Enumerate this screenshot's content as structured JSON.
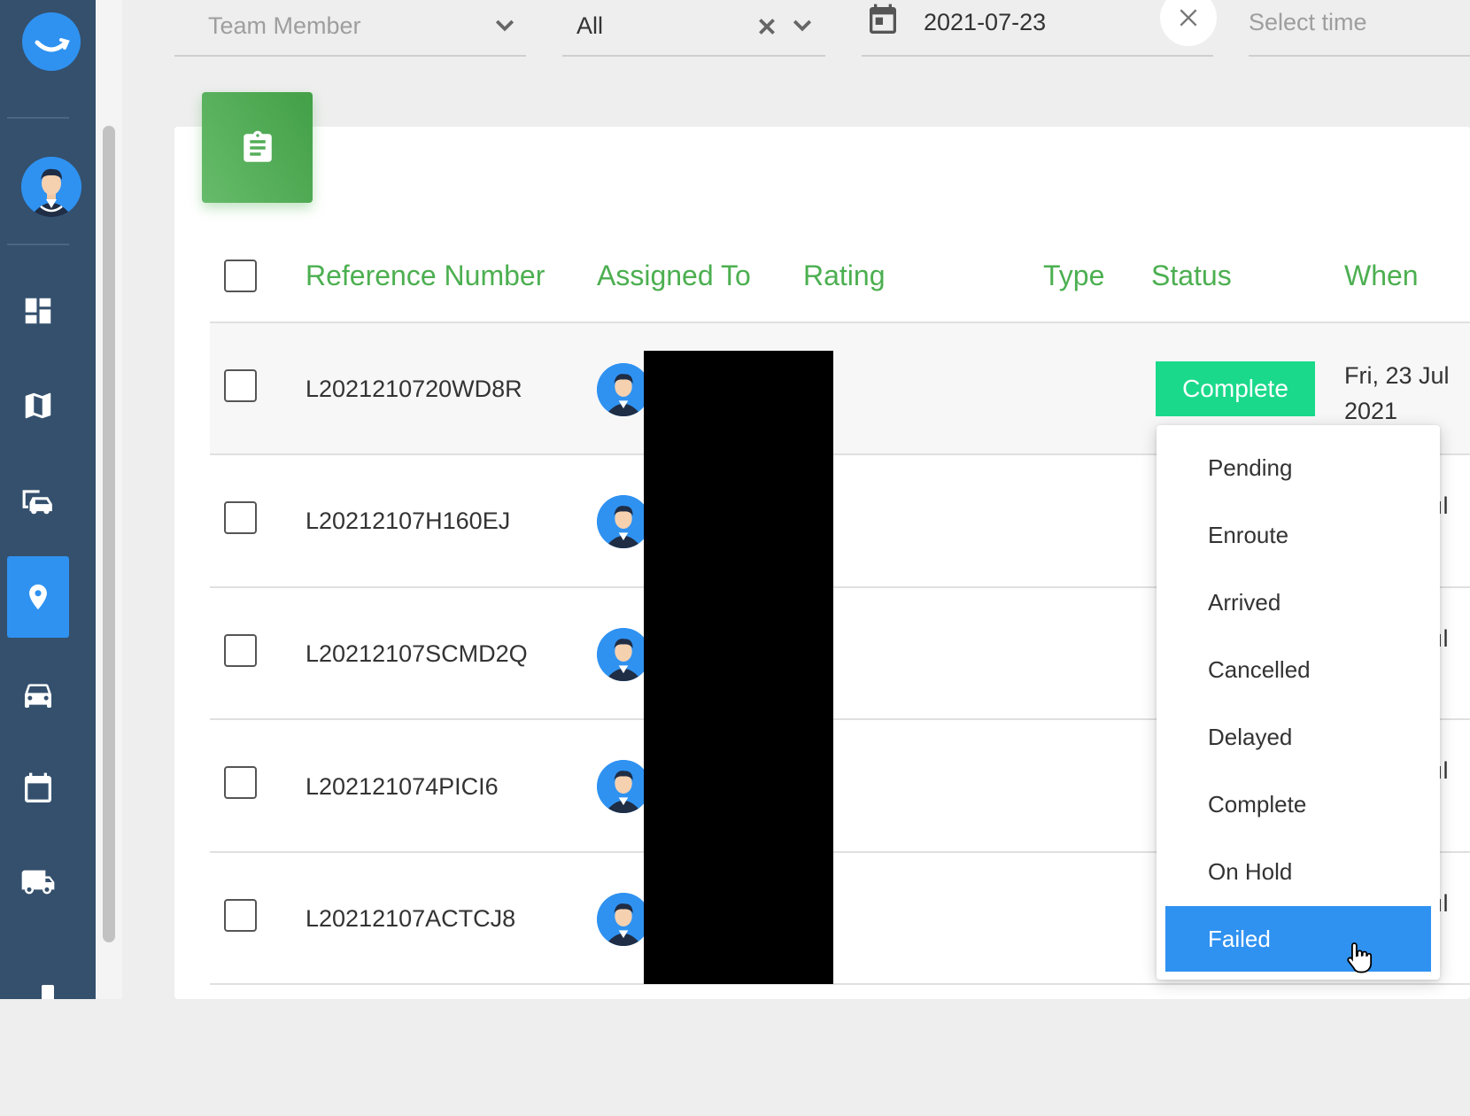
{
  "filters": {
    "team_member_placeholder": "Team Member",
    "status_value": "All",
    "date_value": "2021-07-23",
    "time_placeholder": "Select time"
  },
  "table": {
    "columns": [
      "Reference Number",
      "Assigned To",
      "Rating",
      "Type",
      "Status",
      "When"
    ],
    "rows": [
      {
        "ref": "L2021210720WD8R",
        "status": "Complete",
        "when_line1": "Fri, 23 Jul",
        "when_line2": "2021"
      },
      {
        "ref": "L20212107H160EJ",
        "when_cut": "ıl"
      },
      {
        "ref": "L20212107SCMD2Q",
        "when_cut": "ıl"
      },
      {
        "ref": "L202121074PICI6",
        "when_cut": "ıl"
      },
      {
        "ref": "L20212107ACTCJ8",
        "when_cut": "ıl"
      }
    ]
  },
  "status_dropdown": {
    "options": [
      "Pending",
      "Enroute",
      "Arrived",
      "Cancelled",
      "Delayed",
      "Complete",
      "On Hold",
      "Failed"
    ],
    "highlighted": "Failed"
  },
  "colors": {
    "sidebar": "#34506d",
    "accent_blue": "#2f92f1",
    "header_green": "#4caf50",
    "status_complete": "#1bd98b"
  },
  "icons": {
    "sidebar": [
      "dashboard-icon",
      "map-icon",
      "vehicles-icon",
      "location-pin-icon",
      "car-icon",
      "calendar-icon",
      "truck-icon"
    ]
  }
}
